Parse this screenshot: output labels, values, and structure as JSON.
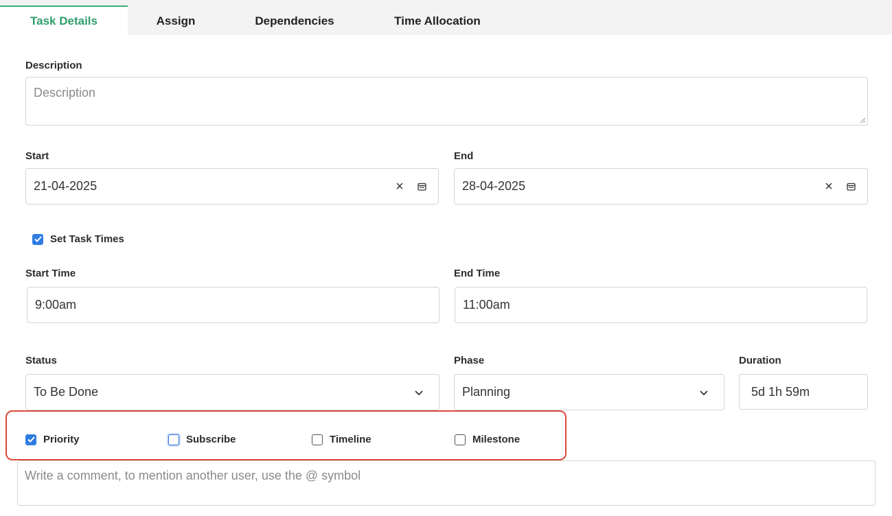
{
  "tabs": [
    {
      "label": "Task Details",
      "active": true
    },
    {
      "label": "Assign",
      "active": false
    },
    {
      "label": "Dependencies",
      "active": false
    },
    {
      "label": "Time Allocation",
      "active": false
    }
  ],
  "description": {
    "label": "Description",
    "placeholder": "Description",
    "value": ""
  },
  "start": {
    "label": "Start",
    "value": "21-04-2025",
    "clear_icon": "close-icon",
    "calendar_icon": "calendar-icon"
  },
  "end": {
    "label": "End",
    "value": "28-04-2025",
    "clear_icon": "close-icon",
    "calendar_icon": "calendar-icon"
  },
  "set_task_times": {
    "label": "Set Task Times",
    "checked": true
  },
  "start_time": {
    "label": "Start Time",
    "value": "9:00am"
  },
  "end_time": {
    "label": "End Time",
    "value": "11:00am"
  },
  "status": {
    "label": "Status",
    "value": "To Be Done"
  },
  "phase": {
    "label": "Phase",
    "value": "Planning"
  },
  "duration": {
    "label": "Duration",
    "value": "5d 1h 59m"
  },
  "options": [
    {
      "label": "Priority",
      "checked": true
    },
    {
      "label": "Subscribe",
      "checked": false,
      "focused": true
    },
    {
      "label": "Timeline",
      "checked": false
    },
    {
      "label": "Milestone",
      "checked": false
    }
  ],
  "comment": {
    "placeholder": "Write a comment, to mention another user, use the @ symbol"
  },
  "colors": {
    "accent": "#35b07a",
    "checkbox": "#2f7de1",
    "highlight": "#d9493a"
  }
}
